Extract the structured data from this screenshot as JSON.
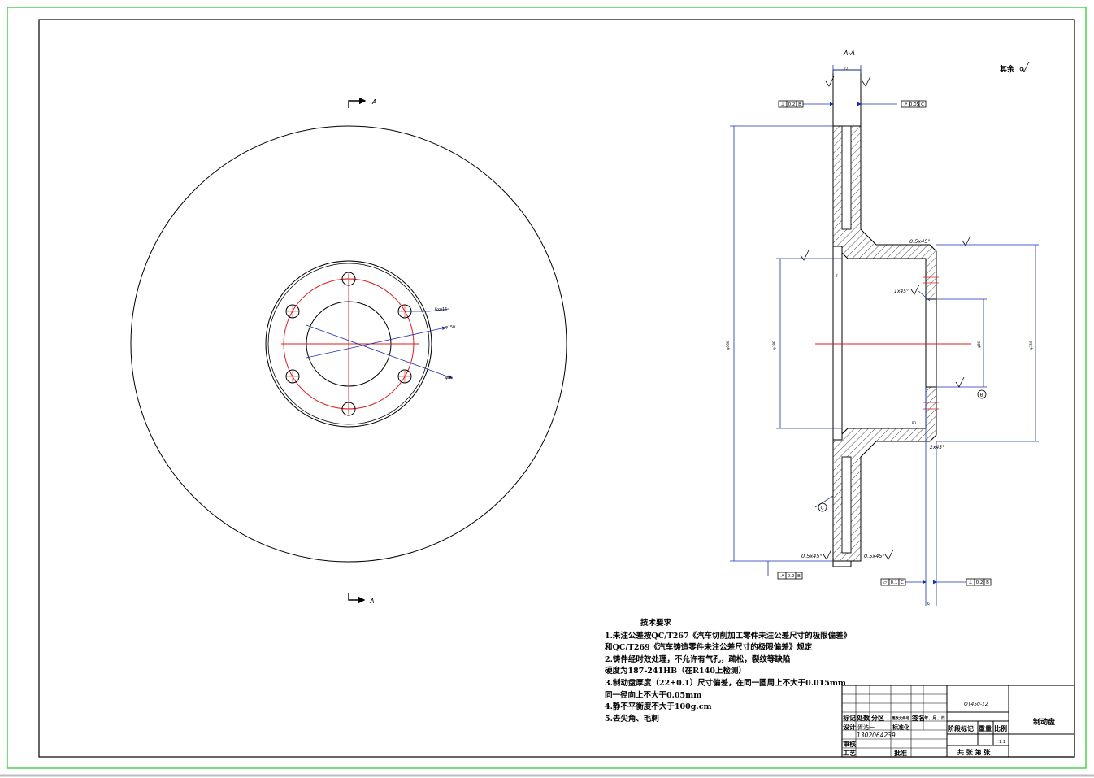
{
  "section_label": "A-A",
  "cut_marker_top": "A",
  "cut_marker_bottom": "A",
  "roughness_note": "其余",
  "dimensions": {
    "thickness_top": "22",
    "outer_diameter": "φ360",
    "hub_left_diameter": "φ180",
    "hub_right_diameter": "φ156",
    "pilot_diameter": "φ86",
    "chamfer_top": "0.5x45°",
    "chamfer_1x45": "1x45°",
    "chamfer_2x45": "2x45°",
    "chamfer_bottom_left": "0.5x45°",
    "chamfer_bottom_right": "0.5x45°",
    "bolt_holes": "6xφ16",
    "bolt_circle": "φ150",
    "hub_bore": "φ86",
    "fillet_r": "R1",
    "small_dim": "7",
    "bottom_dim": "6"
  },
  "datum_tags": {
    "datum_c": "C",
    "datum_b": "B"
  },
  "tolerance_frames": {
    "top_left": [
      "⊥",
      "0.2",
      "B"
    ],
    "top_right": [
      "↗",
      "0.05",
      "C"
    ],
    "bottom_left": [
      "↗",
      "0.2",
      "B"
    ],
    "bottom_mid": [
      "▱",
      "0.1",
      "C"
    ],
    "bottom_right": [
      "⊥",
      "0.2",
      "B"
    ]
  },
  "tech_requirements": {
    "title": "技术要求",
    "lines": [
      "1.未注公差按QC/T267《汽车切削加工零件未注公差尺寸的极限偏差》",
      "和QC/T269《汽车铸造零件未注公差尺寸的极限偏差》规定",
      "2.铸件经时效处理，不允许有气孔，疏松，裂纹等缺陷",
      "   硬度为187-241HB（在R140上检测）",
      "3.制动盘厚度（22±0.1）尺寸偏差，在同一圆周上不大于0.015mm",
      "   同一径向上不大于0.05mm",
      "4.静不平衡度不大于100g.cm",
      "5.去尖角、毛刺"
    ]
  },
  "title_block": {
    "material": "QT450-12",
    "part_name": "制动盘",
    "h_mark": "标记",
    "h_count": "处数",
    "h_zone": "分区",
    "h_docno": "更改文件号",
    "h_sign": "签名",
    "h_date": "年、月、日",
    "design_label": "设计",
    "designer": "胥浩一",
    "standard_label": "标准化",
    "student_id": "1302064239",
    "review_label": "审核",
    "process_label": "工艺",
    "approve_label": "批准",
    "stage_label": "阶段标记",
    "weight_label": "重量",
    "scale_label": "比例",
    "scale_value": "1:1",
    "sheets_label": "共  张  第  张"
  }
}
